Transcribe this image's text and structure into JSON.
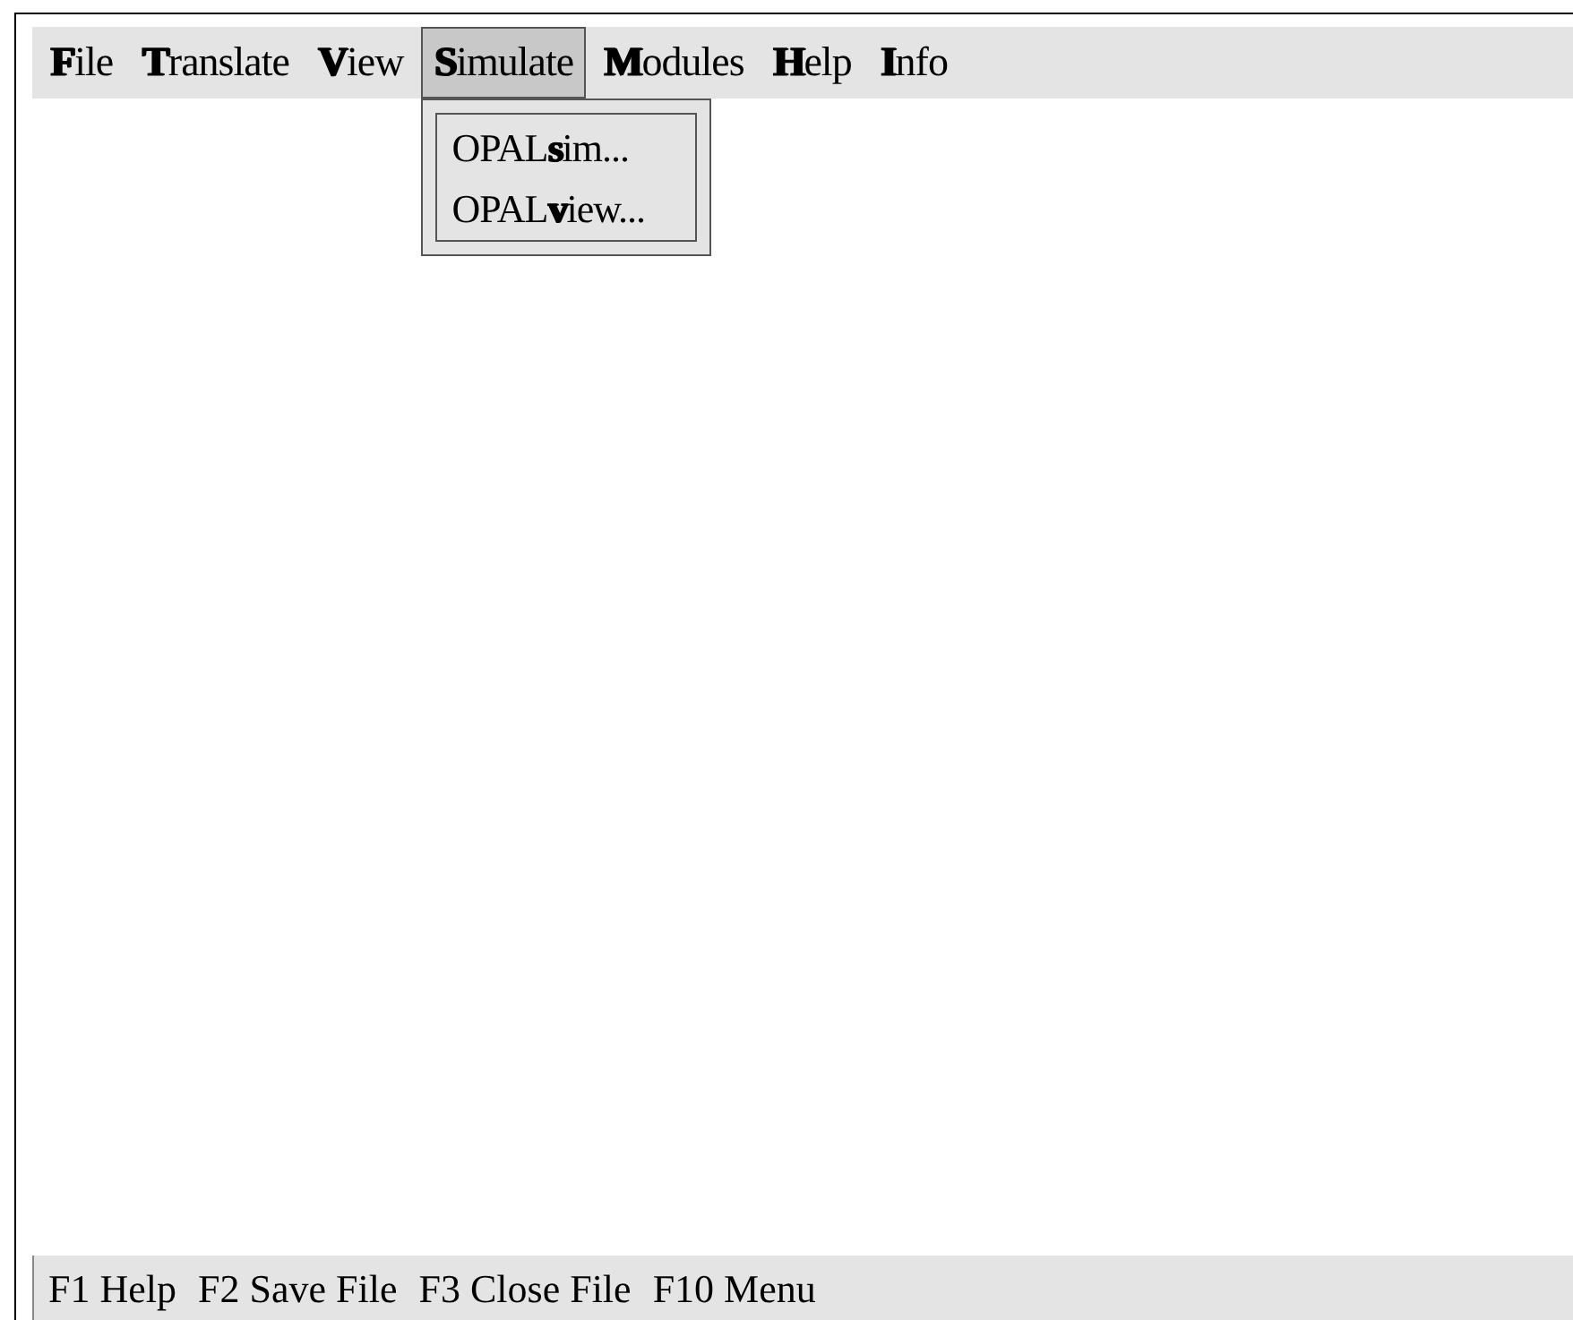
{
  "menu_bar": [
    {
      "label": "**F**ile",
      "selected": false
    },
    {
      "label": "**T**ranslate",
      "selected": false
    },
    {
      "label": "**V**iew",
      "selected": false
    },
    {
      "label": "**S**imulate",
      "selected": true
    },
    {
      "label": "**M**odules",
      "selected": false
    },
    {
      "label": "**H**elp",
      "selected": false
    },
    {
      "label": "**I**nfo",
      "selected": false
    }
  ],
  "dropdown": {
    "items": [
      "OPAL**s**im...",
      "OPAL**v**iew..."
    ]
  },
  "status_bar": [
    "F1 Help",
    "F2 Save File",
    "F3 Close File",
    "F10 Menu"
  ]
}
